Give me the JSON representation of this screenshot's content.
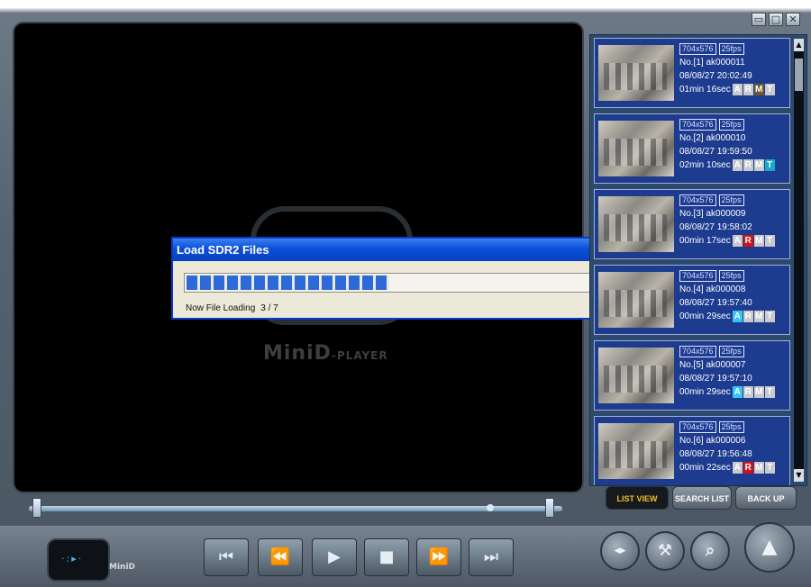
{
  "window": {
    "minimize_glyph": "▭",
    "restore_glyph": "□",
    "close_glyph": "✕"
  },
  "player": {
    "logo_main": "MiniD",
    "logo_sub": "-PLAYER"
  },
  "dialog": {
    "title": "Load SDR2 Files",
    "status_label": "Now File Loading",
    "progress_text": "3 / 7",
    "progress_fraction": 0.45
  },
  "files": [
    {
      "resolution": "704x576",
      "fps": "25fps",
      "name": "No.[1] ak000011",
      "datetime": "08/08/27 20:02:49",
      "duration": "01min 16sec",
      "flags": {
        "A": false,
        "R": false,
        "M": true,
        "T": false
      }
    },
    {
      "resolution": "704x576",
      "fps": "25fps",
      "name": "No.[2] ak000010",
      "datetime": "08/08/27 19:59:50",
      "duration": "02min 10sec",
      "flags": {
        "A": false,
        "R": false,
        "M": false,
        "T": true
      }
    },
    {
      "resolution": "704x576",
      "fps": "25fps",
      "name": "No.[3] ak000009",
      "datetime": "08/08/27 19:58:02",
      "duration": "00min 17sec",
      "flags": {
        "A": false,
        "R": true,
        "M": false,
        "T": false
      }
    },
    {
      "resolution": "704x576",
      "fps": "25fps",
      "name": "No.[4] ak000008",
      "datetime": "08/08/27 19:57:40",
      "duration": "00min 29sec",
      "flags": {
        "A": true,
        "R": false,
        "M": false,
        "T": false
      }
    },
    {
      "resolution": "704x576",
      "fps": "25fps",
      "name": "No.[5] ak000007",
      "datetime": "08/08/27 19:57:10",
      "duration": "00min 29sec",
      "flags": {
        "A": true,
        "R": false,
        "M": false,
        "T": false
      }
    },
    {
      "resolution": "704x576",
      "fps": "25fps",
      "name": "No.[6] ak000006",
      "datetime": "08/08/27 19:56:48",
      "duration": "00min 22sec",
      "flags": {
        "A": false,
        "R": true,
        "M": false,
        "T": false
      }
    }
  ],
  "list_tabs": {
    "list_view": "LIST VIEW",
    "search_list": "SEARCH LIST",
    "back_up": "BACK UP"
  },
  "brand": {
    "label": "MiniD"
  },
  "controls": {
    "first": "⏮",
    "rewind": "⏪",
    "play": "▶",
    "stop": "■",
    "forward": "⏩",
    "last": "⏭"
  },
  "round_buttons": {
    "audio": "◂▸",
    "tools": "⚒",
    "zoom": "⌕",
    "eject": "▲"
  },
  "colors": {
    "accent": "#1d3b8f",
    "dialog_title": "#0a4fd8",
    "progress": "#2d6ad9"
  }
}
